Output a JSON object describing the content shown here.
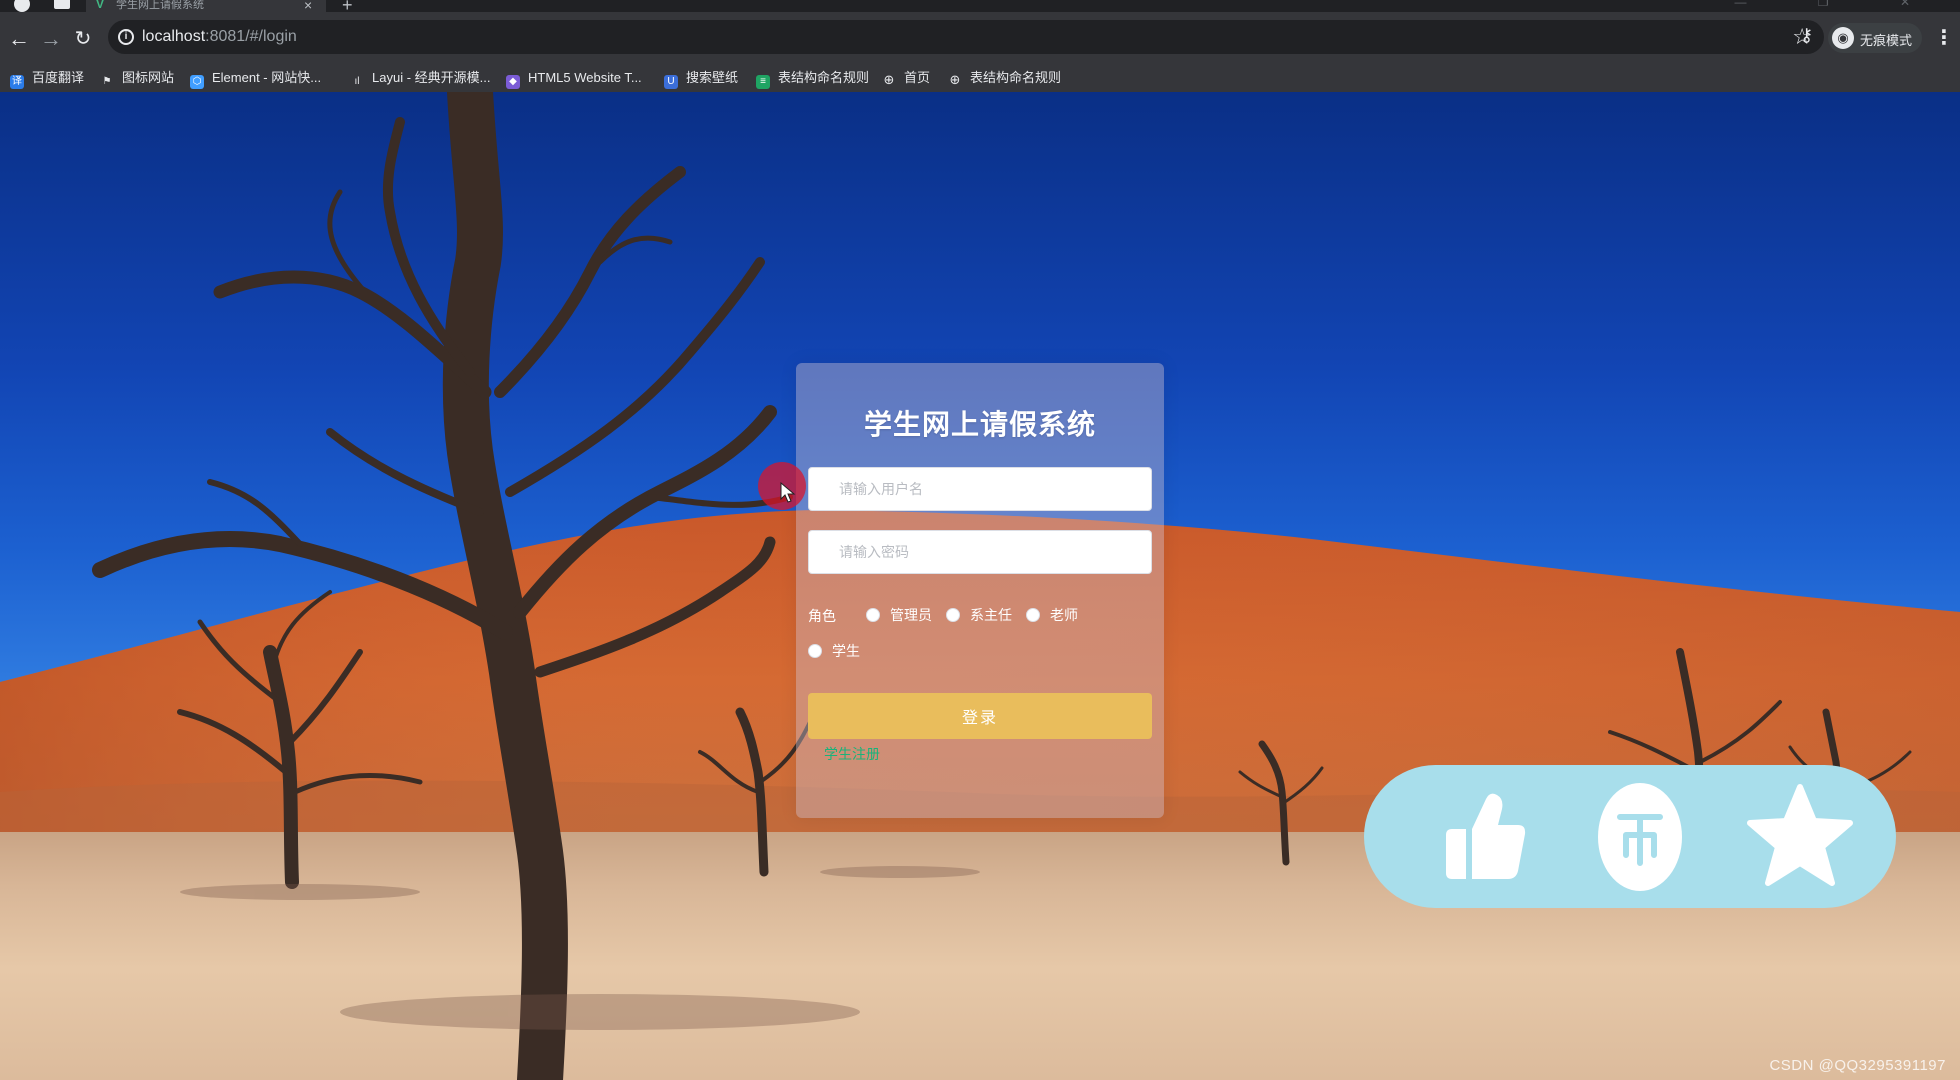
{
  "browser": {
    "tab_title": "学生网上请假系统",
    "url_host": "localhost",
    "url_rest": ":8081/#/login",
    "profile_label": "无痕模式",
    "bookmarks": [
      {
        "label": "百度翻译",
        "icon": "translate-icon",
        "color": "#2b7ce9"
      },
      {
        "label": "图标网站",
        "icon": "flag-icon",
        "color": "#202124"
      },
      {
        "label": "Element - 网站快...",
        "icon": "element-icon",
        "color": "#409eff"
      },
      {
        "label": "Layui - 经典开源模...",
        "icon": "layui-icon",
        "color": "#5fb878"
      },
      {
        "label": "HTML5 Website T...",
        "icon": "html5-icon",
        "color": "#7b5cd6"
      },
      {
        "label": "搜索壁纸",
        "icon": "wallpaper-icon",
        "color": "#3b6ed9"
      },
      {
        "label": "表结构命名规则",
        "icon": "sheet-icon",
        "color": "#1fa463"
      },
      {
        "label": "首页",
        "icon": "globe-icon",
        "color": "#5f6368"
      },
      {
        "label": "表结构命名规则",
        "icon": "globe-icon",
        "color": "#5f6368"
      }
    ]
  },
  "login": {
    "title": "学生网上请假系统",
    "username_placeholder": "请输入用户名",
    "password_placeholder": "请输入密码",
    "role_label": "角色",
    "roles": [
      "管理员",
      "系主任",
      "老师",
      "学生"
    ],
    "login_button": "登录",
    "register_link": "学生注册"
  },
  "actions": {
    "like": "thumbs-up-icon",
    "coin": "coin-icon",
    "favorite": "star-icon",
    "bar_color": "#a8deeb"
  },
  "watermark": "CSDN @QQ3295391197",
  "colors": {
    "login_button": "#e9bd5c",
    "register_link": "#19b37a",
    "sky_top": "#0a2f86",
    "dune": "#d0642d"
  }
}
